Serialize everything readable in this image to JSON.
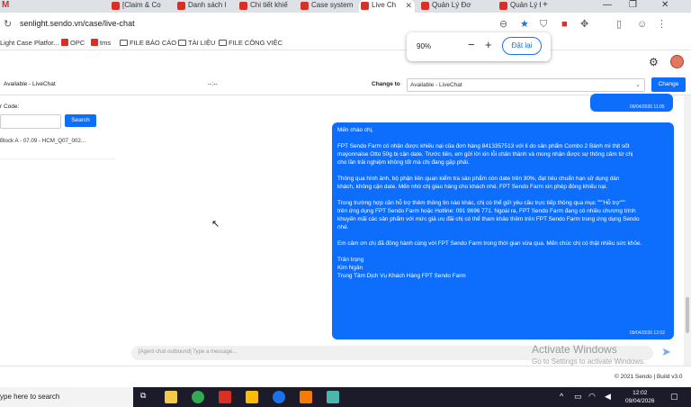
{
  "browser": {
    "tabs": [
      {
        "label": "[Claim & Co",
        "fav": "#d93025"
      },
      {
        "label": "Danh sách l",
        "fav": "#d93025"
      },
      {
        "label": "Chi tiết khiế",
        "fav": "#d93025"
      },
      {
        "label": "Case system",
        "fav": "#d93025"
      },
      {
        "label": "Live Ch",
        "fav": "#d93025"
      },
      {
        "label": "Quản Lý Đơ",
        "fav": "#d93025"
      },
      {
        "label": "Quản Lý Đơ",
        "fav": "#d93025"
      }
    ],
    "url": "senlight.sendo.vn/case/live-chat",
    "bookmarks": [
      "Light Case Platfor...",
      "OPC",
      "tms",
      "FILE BÁO CÁO",
      "TÀI LIỆU",
      "FILE CÔNG VIỆC"
    ],
    "zoom": {
      "value": "90%",
      "minus": "−",
      "plus": "+",
      "reset": "Đặt lại"
    }
  },
  "header": {
    "status_text": "Available - LiveChat",
    "dash": "--:--",
    "change_to_label": "Change to",
    "change_select_value": "Available - LiveChat",
    "change_button": "Change"
  },
  "left_panel": {
    "order_code_label": "r Code:",
    "search_button": "Search",
    "conversation_item": "Block A - 07.09 - HCM_Q07_002..."
  },
  "chat": {
    "prev_timestamp": "09/04/2026 11:05",
    "message_text": "Mến chào chị,\n\nFPT Sendo Farm có nhận được khiếu nại của đơn hàng 8413357513 với lí do sản phẩm Combo 2 Bánh mì thịt sốt\nmayonnaise Otto 50g bị cận date. Trước tiên, em gửi lời xin lỗi chân thành và mong nhận được sự thông cảm từ chị\ncho lần trải nghiệm không tốt mà chị đang gặp phải.\n\nThông qua hình ảnh, bộ phận liên quan kiểm tra sản phẩm còn date trên 30%, đạt tiêu chuẩn hạn sử dụng dán\nkhách, không cận date. Mến nhờ chị giao hàng cho khách nhé. FPT Sendo Farm xin phép đóng khiếu nại.\n\nTrong trường hợp cần hỗ trợ thêm thông tin nào khác, chị có thể gửi yêu cầu trực tiếp thông qua mục \"\"\"Hỗ trợ\"\"\"\ntrên ứng dụng FPT Sendo Farm hoặc Hotline: 091 9696 771. Ngoài ra, FPT Sendo Farm đang có nhiều chương trình\nkhuyến mãi các sản phẩm với mức giá ưu đãi chị có thể tham khảo thêm trên FPT Sendo Farm trong ứng dụng Sendo\nnhé.\n\nEm cảm ơn chị đã đồng hành cùng với FPT Sendo Farm trong thời gian vừa qua. Mến chúc chị có thật nhiều sức khỏe.\n\nTrân trọng\nKim Ngân\nTrung Tâm Dịch Vụ Khách Hàng FPT Sendo Farm",
    "message_timestamp": "09/04/2026 12:02",
    "input_placeholder": "[Agent chat outbound] Type a message...",
    "watermark_title": "Activate Windows",
    "watermark_sub": "Go to Settings to activate Windows."
  },
  "footer": {
    "text": "© 2021 Sendo | Build v3.0"
  },
  "taskbar": {
    "search_text": "ype here to search",
    "time": "12:02",
    "date": "09/04/2026"
  }
}
